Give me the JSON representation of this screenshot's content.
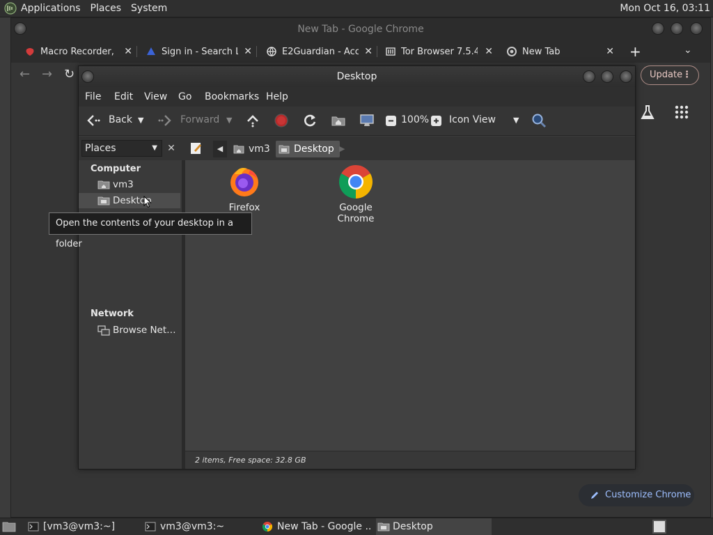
{
  "top_panel": {
    "menus": [
      "Applications",
      "Places",
      "System"
    ],
    "clock": "Mon Oct 16, 03:11"
  },
  "chrome": {
    "window_title": "New Tab - Google Chrome",
    "tabs": [
      {
        "title": "Macro Recorder, M",
        "icon": "macro-recorder-icon"
      },
      {
        "title": "Sign in - Search La",
        "icon": "search-labs-icon"
      },
      {
        "title": "E2Guardian - Acce",
        "icon": "globe-icon"
      },
      {
        "title": "Tor Browser 7.5.4",
        "icon": "tor-icon"
      },
      {
        "title": "New Tab",
        "icon": "chrome-icon"
      }
    ],
    "update_label": "Update",
    "customize_label": "Customize Chrome"
  },
  "caja": {
    "title": "Desktop",
    "menu": [
      "File",
      "Edit",
      "View",
      "Go",
      "Bookmarks",
      "Help"
    ],
    "toolbar": {
      "back": "Back",
      "forward": "Forward",
      "zoom": "100%",
      "view_mode": "Icon View"
    },
    "sidebar_selector": "Places",
    "breadcrumbs": [
      "vm3",
      "Desktop"
    ],
    "sidebar": {
      "computer_header": "Computer",
      "computer_items": [
        "vm3",
        "Desktop"
      ],
      "network_header": "Network",
      "network_items": [
        "Browse Net…"
      ]
    },
    "desktop_items": [
      "Firefox",
      "Google Chrome"
    ],
    "status": "2 items, Free space: 32.8 GB"
  },
  "tooltip": "Open the contents of your desktop in a folder",
  "taskbar": {
    "tasks": [
      "[vm3@vm3:~]",
      "vm3@vm3:~",
      "New Tab - Google ...",
      "Desktop"
    ]
  }
}
